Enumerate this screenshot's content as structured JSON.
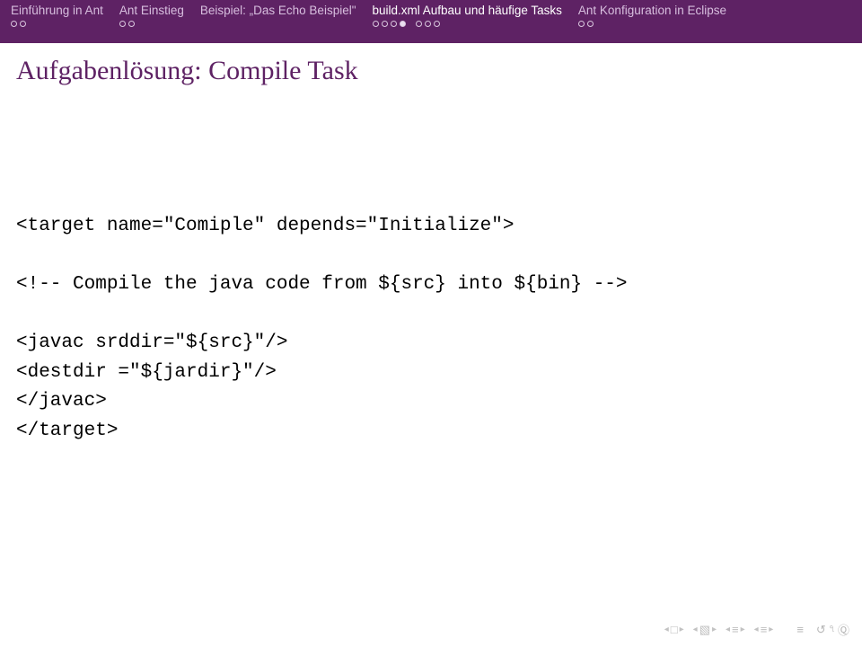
{
  "header": {
    "sections": [
      {
        "title": "Einführung in Ant",
        "active": false,
        "dots": [
          [
            0,
            0
          ]
        ]
      },
      {
        "title": "Ant Einstieg",
        "active": false,
        "dots": [
          [
            0,
            0
          ]
        ]
      },
      {
        "title": "Beispiel: „Das Echo Beispiel\"",
        "active": false,
        "dots": []
      },
      {
        "title": "build.xml Aufbau und häufige Tasks",
        "active": true,
        "dots": [
          [
            0,
            0,
            0,
            1
          ],
          [
            0,
            0,
            0
          ]
        ]
      },
      {
        "title": "Ant Konfiguration in Eclipse",
        "active": false,
        "dots": [
          [
            0,
            0
          ]
        ]
      }
    ]
  },
  "slide": {
    "title": "Aufgabenlösung: Compile Task"
  },
  "code": {
    "l1": "<target name=\"Comiple\" depends=\"Initialize\">",
    "l2": "<!-- Compile the java code from ${src} into ${bin} -->",
    "l3": "<javac srddir=\"${src}\"/>",
    "l4": "<destdir =\"${jardir}\"/>",
    "l5": "</javac>",
    "l6": "</target>"
  },
  "nav": {
    "slide": "□",
    "frame": "▧",
    "sub": "≡",
    "refresh": "↺",
    "mag": "Ⓠ"
  }
}
